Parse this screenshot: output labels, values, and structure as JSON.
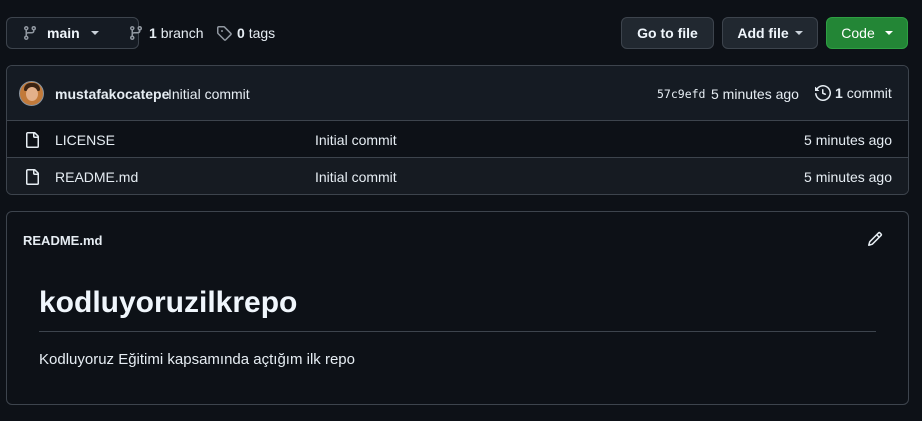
{
  "toolbar": {
    "branch_button": {
      "label": "main",
      "icon": "git-branch-icon"
    },
    "branches": {
      "count": "1",
      "label": "branch",
      "icon": "git-branch-icon"
    },
    "tags": {
      "count": "0",
      "label": "tags",
      "icon": "tag-icon"
    },
    "go_to_file": "Go to file",
    "add_file": "Add file",
    "code": "Code"
  },
  "latest_commit": {
    "author": "mustafakocatepe",
    "message": "Initial commit",
    "sha": "57c9efd",
    "time": "5 minutes ago",
    "count": "1",
    "count_label": "commit",
    "history_icon": "history-icon"
  },
  "files": [
    {
      "name": "LICENSE",
      "commit": "Initial commit",
      "time": "5 minutes ago",
      "icon": "file-icon"
    },
    {
      "name": "README.md",
      "commit": "Initial commit",
      "time": "5 minutes ago",
      "icon": "file-icon"
    }
  ],
  "readme": {
    "filename": "README.md",
    "heading": "kodluyoruzilkrepo",
    "body": "Kodluyoruz Eğitimi kapsamında açtığım ilk repo",
    "edit_icon": "pencil-icon"
  },
  "colors": {
    "background": "#0d1117",
    "border": "#3d444d",
    "code_button": "#238636",
    "text": "#e6edf3"
  }
}
